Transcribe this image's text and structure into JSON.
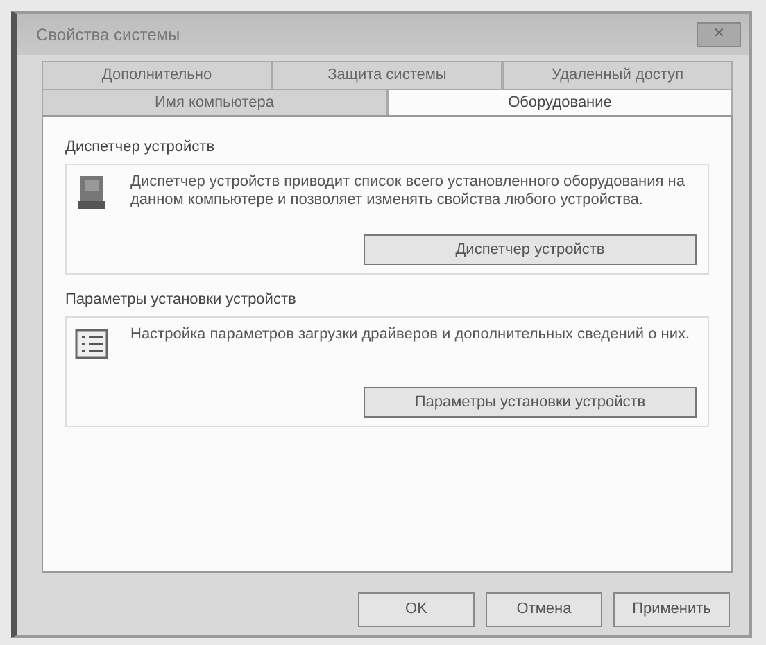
{
  "window": {
    "title": "Свойства системы",
    "close": "✕"
  },
  "tab_rows": [
    [
      {
        "label": "Дополнительно",
        "selected": false
      },
      {
        "label": "Защита системы",
        "selected": false
      },
      {
        "label": "Удаленный доступ",
        "selected": false
      }
    ],
    [
      {
        "label": "Имя компьютера",
        "selected": false
      },
      {
        "label": "Оборудование",
        "selected": true
      }
    ]
  ],
  "groups": [
    {
      "title": "Диспетчер устройств",
      "kind": "device",
      "text": "Диспетчер устройств приводит список всего установленного оборудования на данном компьютере и позволяет изменять свойства любого устройства.",
      "button": "Диспетчер устройств"
    },
    {
      "title": "Параметры установки устройств",
      "kind": "settings",
      "text": "Настройка параметров загрузки драйверов и дополнительных сведений о них.",
      "button": "Параметры установки устройств"
    }
  ],
  "buttons": [
    "OK",
    "Отмена",
    "Применить"
  ]
}
